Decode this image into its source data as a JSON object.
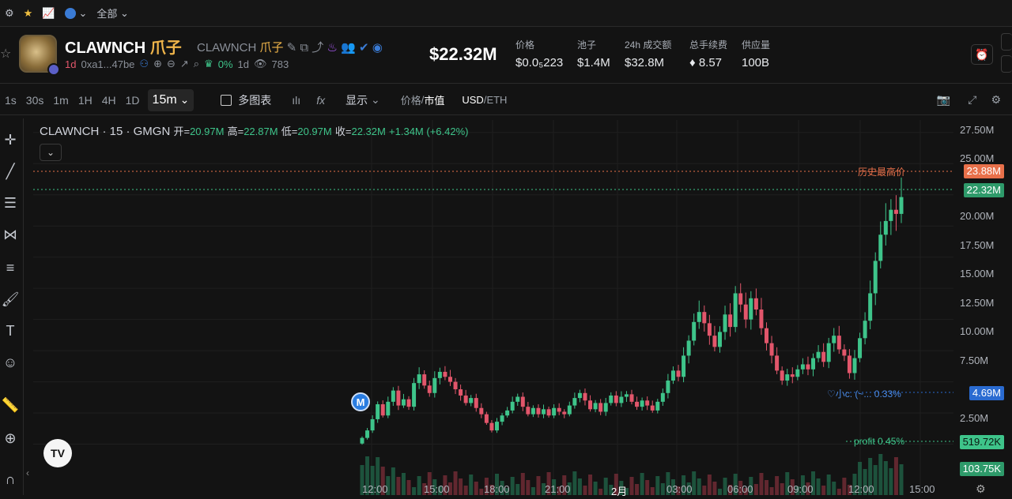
{
  "topbar": {
    "all_label": "全部"
  },
  "token": {
    "symbol": "CLAWNCH",
    "symbol_cn": "爪子",
    "symbol2": "CLAWNCH",
    "symbol2_cn": "爪子",
    "age": "1d",
    "address": "0xa1...47be",
    "holders_pct": "0%",
    "holders_age": "1d",
    "views": "783"
  },
  "market": {
    "market_cap": "$22.32M",
    "stats": [
      {
        "label": "价格",
        "value": "$0.0₅223"
      },
      {
        "label": "池子",
        "value": "$1.4M"
      },
      {
        "label": "24h 成交额",
        "value": "$32.8M"
      },
      {
        "label": "总手续费",
        "value": "♦ 8.57"
      },
      {
        "label": "供应量",
        "value": "100B"
      }
    ]
  },
  "toolbar": {
    "timeframes": [
      "1s",
      "30s",
      "1m",
      "1H",
      "4H",
      "1D"
    ],
    "active_timeframe": "15m",
    "multi_chart": "多图表",
    "display": "显示",
    "price_label": "价格",
    "mcap_label": "市值",
    "usd_label": "USD",
    "eth_label": "ETH"
  },
  "legend": {
    "title": "CLAWNCH · 15 · GMGN",
    "open_label": "开=",
    "open": "20.97M",
    "high_label": "高=",
    "high": "22.87M",
    "low_label": "低=",
    "low": "20.97M",
    "close_label": "收=",
    "close": "22.32M",
    "change": "+1.34M (+6.42%)"
  },
  "price_labels": {
    "ath_text": "历史最高价",
    "ath": "23.88M",
    "current": "22.32M",
    "small_text": "♡小c. (~... 0.33%",
    "small": "4.69M",
    "profit_text": "profit 0.45%",
    "profit": "519.72K",
    "volume": "103.75K"
  },
  "marker": "M",
  "chart_data": {
    "type": "candlestick",
    "title": "CLAWNCH · 15 · GMGN",
    "y_ticks": [
      "27.50M",
      "25.00M",
      "22.50M",
      "20.00M",
      "17.50M",
      "15.00M",
      "12.50M",
      "10.00M",
      "7.50M",
      "5.00M",
      "2.50M"
    ],
    "x_ticks": [
      "12:00",
      "15:00",
      "18:00",
      "21:00",
      "2月",
      "03:00",
      "06:00",
      "09:00",
      "12:00",
      "15:00"
    ],
    "ylim": [
      0,
      30
    ],
    "colors": {
      "up": "#3ec48a",
      "down": "#e2566b"
    },
    "candles_close_millions": [
      3.0,
      3.6,
      4.5,
      5.7,
      4.8,
      5.9,
      6.8,
      5.6,
      6.1,
      5.5,
      7.4,
      8.1,
      7.2,
      6.6,
      7.8,
      8.3,
      7.9,
      7.5,
      6.9,
      6.4,
      5.8,
      6.2,
      5.4,
      4.9,
      4.2,
      3.6,
      4.3,
      4.8,
      5.2,
      5.9,
      6.3,
      5.5,
      4.9,
      5.4,
      4.9,
      5.3,
      4.8,
      5.4,
      5.1,
      4.9,
      5.6,
      6.2,
      6.6,
      6.0,
      5.3,
      5.8,
      5.1,
      5.8,
      6.4,
      5.8,
      6.3,
      6.5,
      5.9,
      5.5,
      6.0,
      5.6,
      5.2,
      5.9,
      6.6,
      7.6,
      8.4,
      7.9,
      9.6,
      10.8,
      12.3,
      13.1,
      12.2,
      11.2,
      10.3,
      11.5,
      12.9,
      11.9,
      14.6,
      13.7,
      12.5,
      14.2,
      13.3,
      11.8,
      10.6,
      9.6,
      8.4,
      7.6,
      8.1,
      7.9,
      8.5,
      8.9,
      8.5,
      9.4,
      9.9,
      9.1,
      10.6,
      11.2,
      10.1,
      9.6,
      8.2,
      9.4,
      11.0,
      12.4,
      14.6,
      17.2,
      19.3,
      20.4,
      21.3,
      20.97,
      22.32
    ]
  }
}
